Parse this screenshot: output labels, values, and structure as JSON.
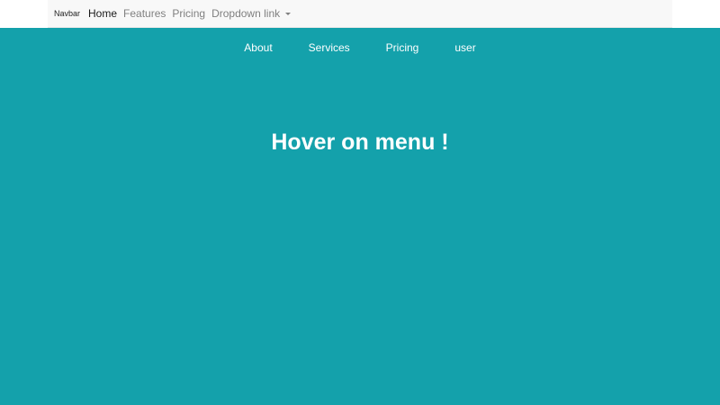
{
  "navbar": {
    "brand": "Navbar",
    "links": [
      {
        "label": "Home"
      },
      {
        "label": "Features"
      },
      {
        "label": "Pricing"
      },
      {
        "label": "Dropdown link",
        "icon": "caret-down-icon"
      }
    ]
  },
  "menu": {
    "items": [
      {
        "label": "About"
      },
      {
        "label": "Services"
      },
      {
        "label": "Pricing"
      },
      {
        "label": "user"
      }
    ]
  },
  "main": {
    "headline": "Hover on menu !"
  },
  "colors": {
    "background": "#14a1ab",
    "navbar_bg": "#f8f8f8",
    "link_muted": "#808080",
    "link_active": "#1a1a1a",
    "menu_text": "#ffffff"
  }
}
